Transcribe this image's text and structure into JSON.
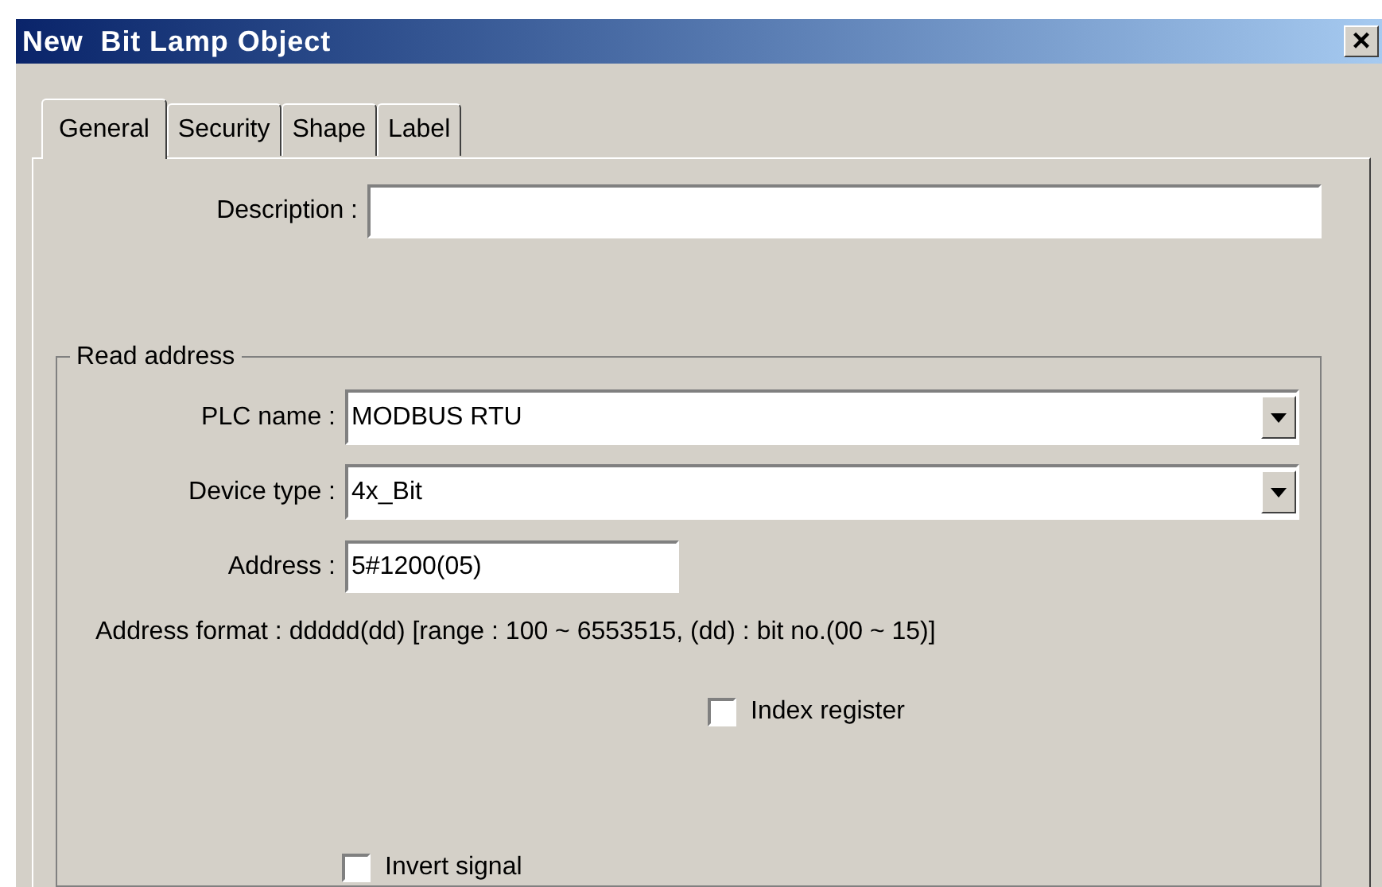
{
  "window": {
    "title": "New  Bit Lamp Object",
    "close": "×"
  },
  "tabs": [
    {
      "label": "General",
      "selected": true
    },
    {
      "label": "Security",
      "selected": false
    },
    {
      "label": "Shape",
      "selected": false
    },
    {
      "label": "Label",
      "selected": false
    }
  ],
  "description": {
    "label": "Description :"
  },
  "read_address": {
    "title": "Read address",
    "fields": [
      {
        "kind": "dropdown",
        "label": "PLC name :",
        "value": "MODBUS RTU"
      },
      {
        "kind": "dropdown",
        "label": "Device type :",
        "value": "4x_Bit"
      },
      {
        "kind": "text",
        "label": "Address :",
        "value": "5#1200(05)"
      }
    ],
    "address_format": "Address format : ddddd(dd) [range : 100 ~ 6553515, (dd) : bit no.(00 ~ 15)]",
    "index_register": {
      "label": "Index register",
      "checked": false
    },
    "invert_signal": {
      "label": "Invert signal",
      "checked": false
    }
  }
}
